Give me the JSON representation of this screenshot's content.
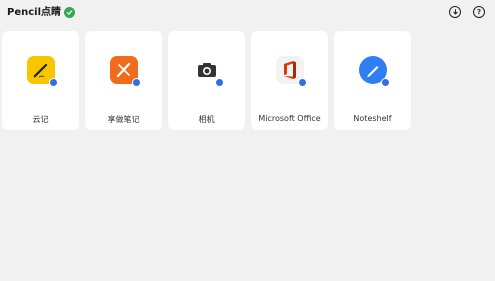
{
  "header": {
    "title": "Pencil点睛",
    "icons": [
      "check-circle-icon",
      "download-icon",
      "help-icon"
    ]
  },
  "apps": [
    {
      "label": "云记",
      "icon": "pen-notes-icon",
      "color": "#f7c600"
    },
    {
      "label": "享做笔记",
      "icon": "notes-pen-icon",
      "color": "#f26b1d"
    },
    {
      "label": "相机",
      "icon": "camera-icon",
      "color": "#ffffff"
    },
    {
      "label": "Microsoft Office",
      "icon": "office-icon",
      "color": "#ffffff"
    },
    {
      "label": "Noteshelf",
      "icon": "noteshelf-icon",
      "color": "#2f7ef2"
    }
  ]
}
